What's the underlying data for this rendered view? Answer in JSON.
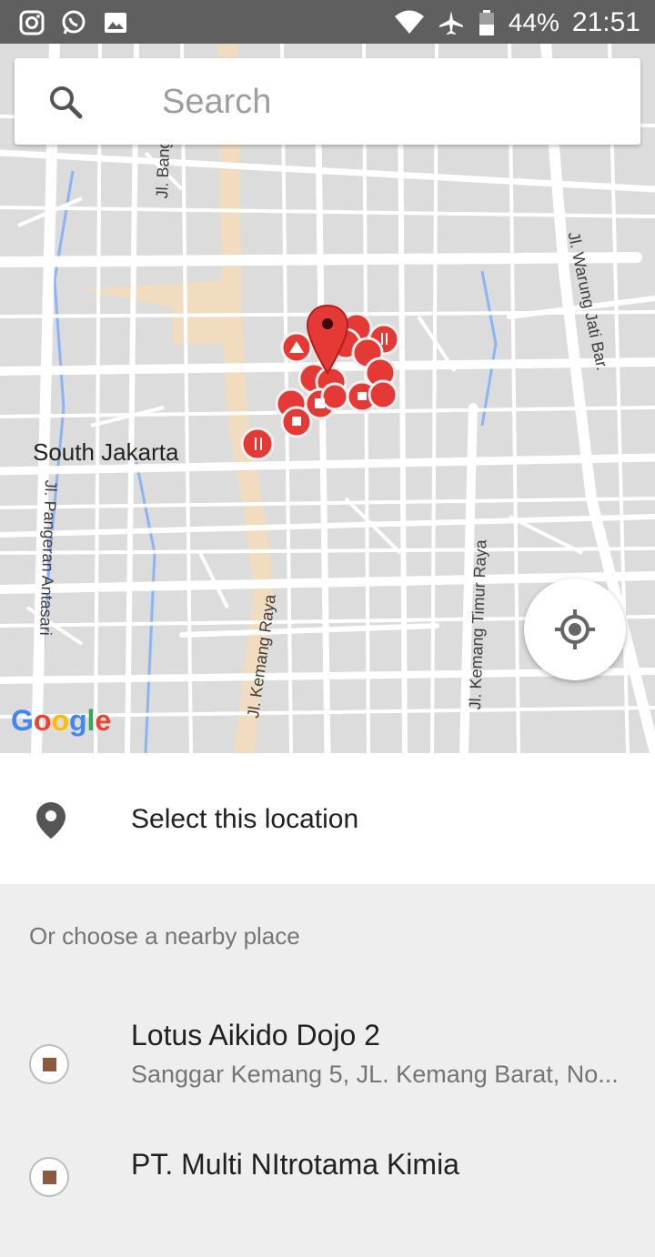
{
  "status_bar": {
    "battery_percent": "44%",
    "time": "21:51",
    "left_icons": [
      "instagram-icon",
      "whatsapp-icon",
      "gallery-icon"
    ],
    "right_icons": [
      "wifi-icon",
      "airplane-icon",
      "battery-icon"
    ]
  },
  "search": {
    "placeholder": "Search"
  },
  "map": {
    "area_label": "South Jakarta",
    "street_labels": [
      "Jl. Bangka Raya",
      "Jl. Warung Jati Bar.",
      "Jl. Pangeran Antasari",
      "Jl. Kemang Raya",
      "Jl. Kemang Timur Raya"
    ],
    "attribution": "Google",
    "colors": {
      "background": "#dcdcdc",
      "street": "#ffffff",
      "highlight_road": "#f2dcc0",
      "water": "#8ab4f8",
      "marker": "#e53935"
    }
  },
  "select_location": {
    "label": "Select this location"
  },
  "nearby": {
    "header": "Or choose a nearby place",
    "places": [
      {
        "name": "Lotus Aikido Dojo 2",
        "address": "Sanggar Kemang 5, JL. Kemang Barat, No..."
      },
      {
        "name": "PT. Multi NItrotama Kimia",
        "address": ""
      }
    ]
  }
}
